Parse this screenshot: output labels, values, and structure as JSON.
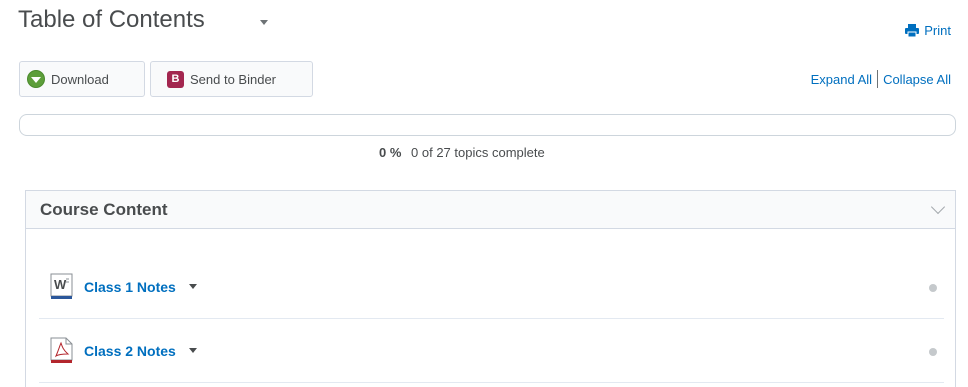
{
  "header": {
    "title": "Table of Contents",
    "print_label": "Print"
  },
  "toolbar": {
    "download_label": "Download",
    "binder_icon_letter": "B",
    "binder_label": "Send to Binder",
    "expand_all_label": "Expand All",
    "collapse_all_label": "Collapse All"
  },
  "progress": {
    "percent_text": "0 %",
    "percent_value": 0,
    "summary": "0 of 27 topics complete"
  },
  "module": {
    "title": "Course Content",
    "topics": [
      {
        "label": "Class 1 Notes",
        "icon": "word-doc-icon",
        "icon_letter": "W"
      },
      {
        "label": "Class 2 Notes",
        "icon": "pdf-doc-icon"
      }
    ]
  },
  "colors": {
    "link": "#006fbf",
    "download_icon": "#5d9e3a",
    "binder_icon": "#a3264f"
  }
}
